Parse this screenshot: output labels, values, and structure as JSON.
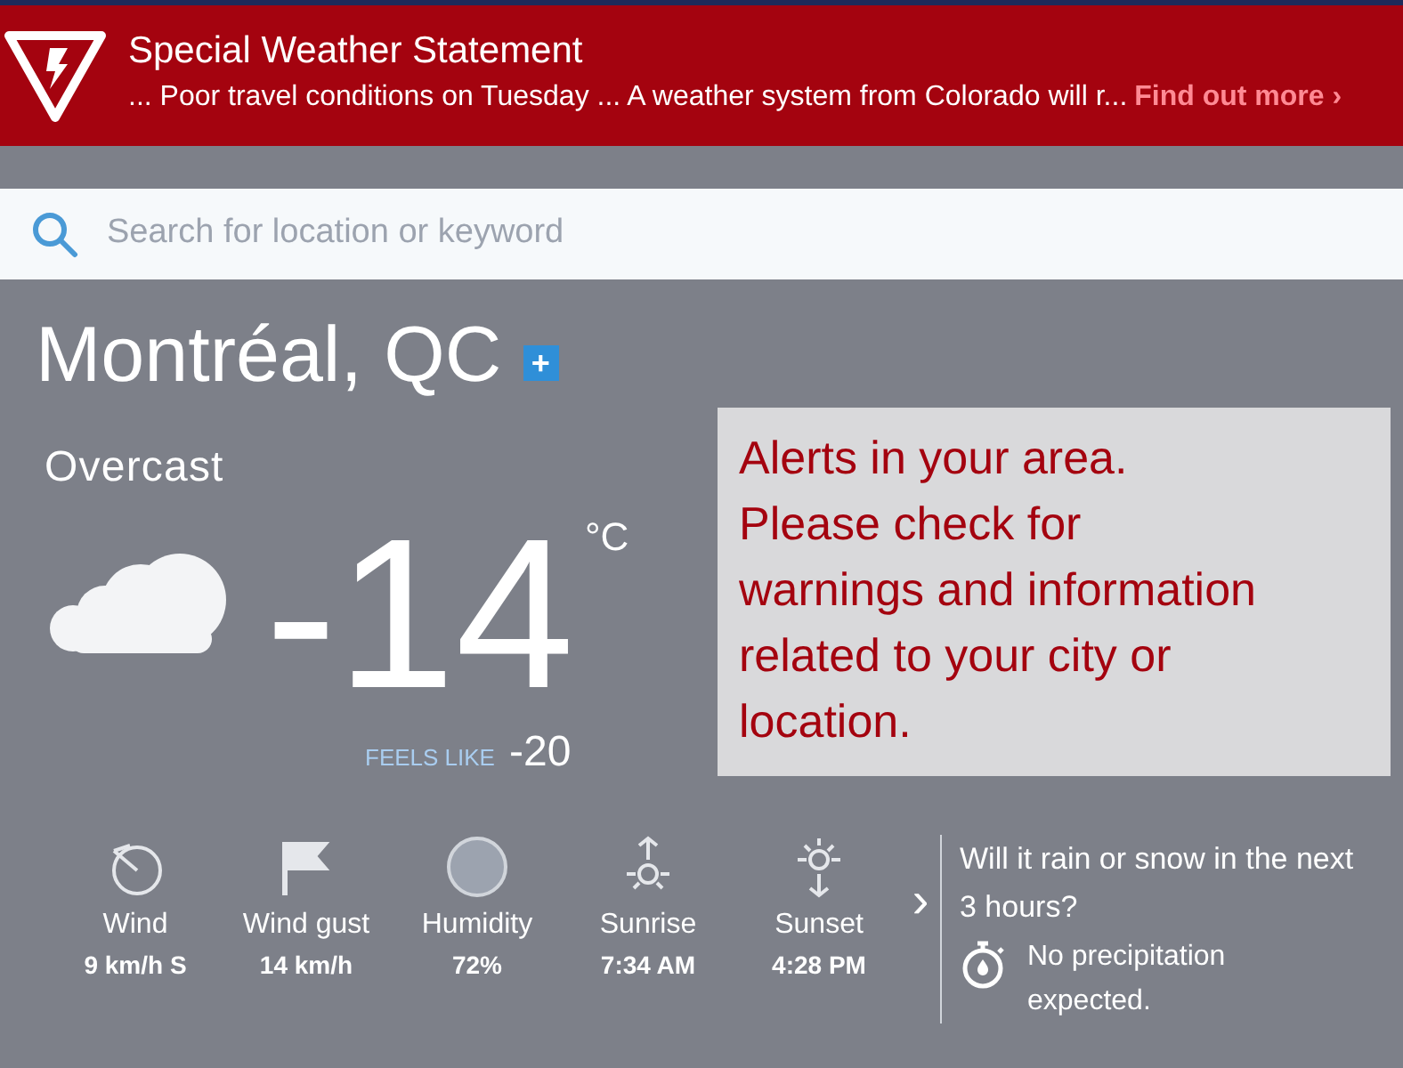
{
  "alert_banner": {
    "title": "Special Weather Statement",
    "summary": "... Poor travel conditions on Tuesday ... A weather system from Colorado will r...",
    "link": "Find out more ›"
  },
  "search": {
    "placeholder": "Search for location or keyword"
  },
  "location": {
    "name": "Montréal, QC",
    "add_label": "+"
  },
  "current": {
    "condition": "Overcast",
    "temperature": "-14",
    "unit": "°C",
    "feels_like_label": "FEELS LIKE",
    "feels_like": "-20"
  },
  "area_alert": {
    "text": "Alerts in your area. Please check for warnings and information related to your city or location."
  },
  "metrics": [
    {
      "kind": "wind",
      "label": "Wind",
      "value": "9 km/h S"
    },
    {
      "kind": "gust",
      "label": "Wind gust",
      "value": "14 km/h"
    },
    {
      "kind": "humidity",
      "label": "Humidity",
      "value": "72%"
    },
    {
      "kind": "sunrise",
      "label": "Sunrise",
      "value": "7:34 AM"
    },
    {
      "kind": "sunset",
      "label": "Sunset",
      "value": "4:28 PM"
    }
  ],
  "next_arrow": "›",
  "precipitation": {
    "question": "Will it rain or snow in the next 3 hours?",
    "answer": "No precipitation expected."
  }
}
